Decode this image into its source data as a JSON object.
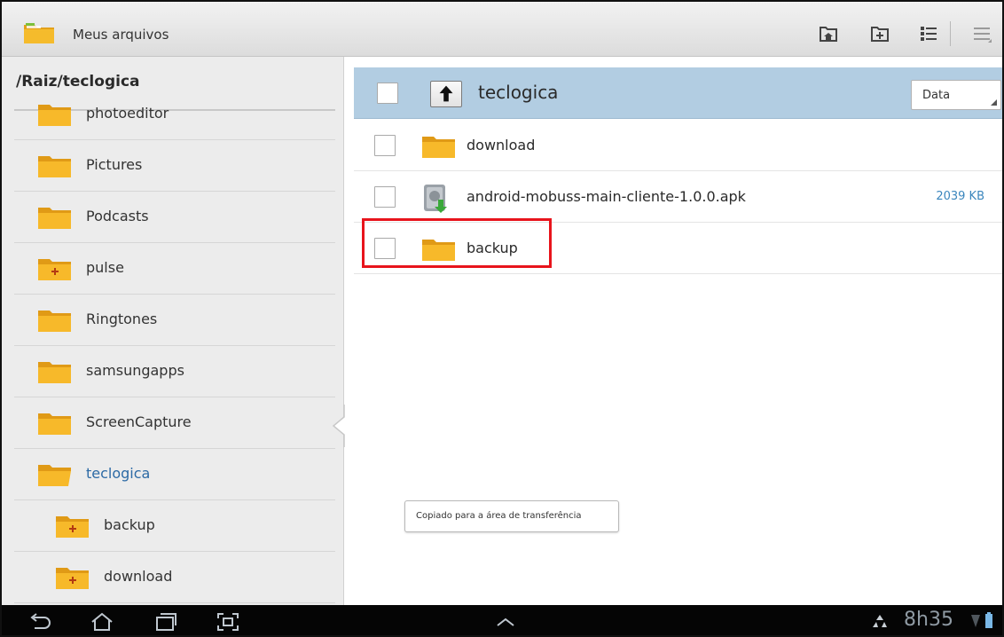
{
  "app": {
    "title": "Meus arquivos"
  },
  "colors": {
    "accent": "#2c6aa5",
    "highlight": "#e8141c",
    "current_row": "#b2cde2",
    "size_text": "#3b86bd"
  },
  "action_bar": {
    "icons": [
      "home-folder-icon",
      "new-folder-icon",
      "list-view-icon",
      "overflow-menu-icon"
    ]
  },
  "left_pane": {
    "path": "/Raiz/teclogica",
    "items": [
      {
        "label": "photoeditor",
        "icon": "folder-icon"
      },
      {
        "label": "Pictures",
        "icon": "folder-icon"
      },
      {
        "label": "Podcasts",
        "icon": "folder-icon"
      },
      {
        "label": "pulse",
        "icon": "folder-plus-icon"
      },
      {
        "label": "Ringtones",
        "icon": "folder-icon"
      },
      {
        "label": "samsungapps",
        "icon": "folder-icon"
      },
      {
        "label": "ScreenCapture",
        "icon": "folder-icon"
      },
      {
        "label": "teclogica",
        "icon": "folder-open-icon",
        "active": true
      },
      {
        "label": "backup",
        "icon": "folder-plus-icon"
      },
      {
        "label": "download",
        "icon": "folder-plus-icon"
      }
    ]
  },
  "right_pane": {
    "current_folder": "teclogica",
    "sort": {
      "selected": "Data"
    },
    "files": [
      {
        "name": "download",
        "type": "folder",
        "size": ""
      },
      {
        "name": "android-mobuss-main-cliente-1.0.0.apk",
        "type": "apk",
        "size": "2039 KB"
      },
      {
        "name": "backup",
        "type": "folder",
        "size": ""
      }
    ]
  },
  "toast": {
    "text": "Copiado para a área de transferência"
  },
  "system_bar": {
    "clock": "8h35",
    "icons": [
      "back-icon",
      "home-icon",
      "recent-apps-icon",
      "screenshot-icon",
      "expand-up-icon",
      "recycle-icon",
      "signal-icon",
      "battery-icon"
    ]
  }
}
